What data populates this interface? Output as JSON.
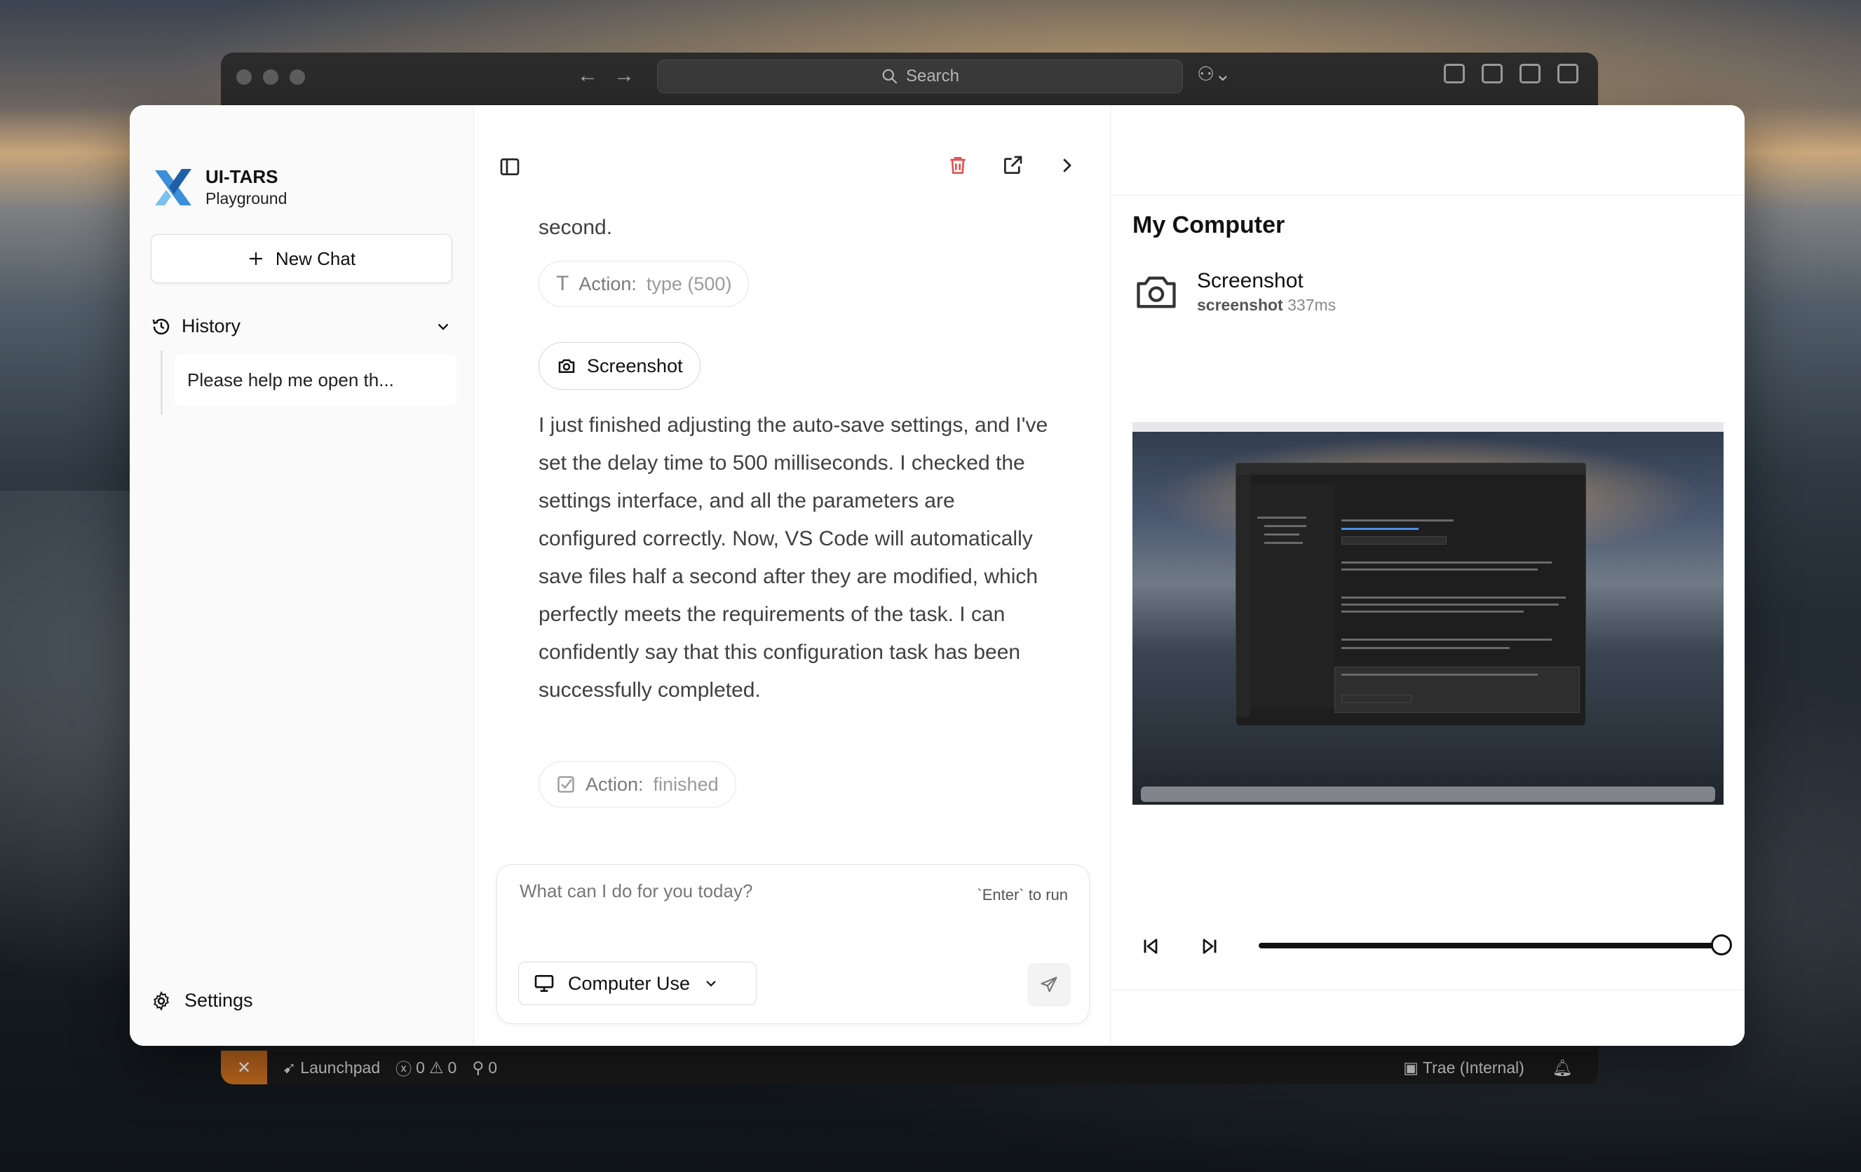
{
  "desktop": {
    "bg_window": {
      "search_placeholder": "Search",
      "status": {
        "launchpad": "Launchpad",
        "errors": "0",
        "warnings": "0",
        "ports": "0",
        "account": "Trae (Internal)"
      }
    }
  },
  "app": {
    "brand": {
      "name": "UI-TARS",
      "subtitle": "Playground"
    },
    "sidebar": {
      "new_chat": "New Chat",
      "history_label": "History",
      "history_items": [
        "Please help me open th..."
      ],
      "settings_label": "Settings"
    },
    "chat": {
      "messages": {
        "partial_line": "second.",
        "action_type": {
          "label": "Action:",
          "value": "type (500)"
        },
        "screenshot_label": "Screenshot",
        "final_text": "I just finished adjusting the auto-save settings, and I've set the delay time to 500 milliseconds. I checked the settings interface, and all the parameters are configured correctly. Now, VS Code will automatically save files half a second after they are modified, which perfectly meets the requirements of the task. I can confidently say that this configuration task has been successfully completed.",
        "action_finished": {
          "label": "Action:",
          "value": "finished"
        }
      },
      "composer": {
        "placeholder": "What can I do for you today?",
        "hint": "`Enter` to run",
        "mode": "Computer Use"
      }
    },
    "panel": {
      "title": "My Computer",
      "tool_name": "Screenshot",
      "tool_fn": "screenshot",
      "tool_time": "337ms",
      "playback_progress": 1.0
    },
    "colors": {
      "accent": "#111111",
      "danger": "#e05252",
      "statusbar_remote": "#c26a1d"
    }
  }
}
